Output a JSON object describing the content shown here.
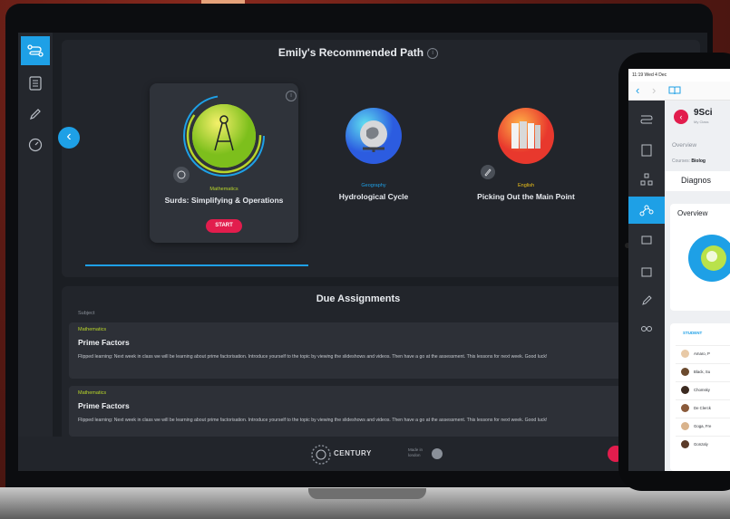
{
  "path": {
    "title": "Emily's Recommended Path",
    "cards": [
      {
        "subject": "Mathematics",
        "topic": "Surds: Simplifying & Operations",
        "start_label": "START",
        "subject_color": "#b9d62a"
      },
      {
        "subject": "Geography",
        "topic": "Hydrological Cycle",
        "subject_color": "#1ea0e6"
      },
      {
        "subject": "English",
        "topic": "Picking Out the Main Point",
        "subject_color": "#f0c419"
      }
    ]
  },
  "assignments": {
    "title": "Due Assignments",
    "subject_header": "Subject",
    "items": [
      {
        "subject": "Mathematics",
        "title": "Prime Factors",
        "desc": "Flipped learning: Next week in class we will be learning about prime factorisation. Introduce yourself to the topic by viewing the slideshows and videos. Then have a go at the assessment. This lessons for next week. Good luck!"
      },
      {
        "subject": "Mathematics",
        "title": "Prime Factors",
        "desc": "Flipped learning: Next week in class we will be learning about prime factorisation. Introduce yourself to the topic by viewing the slideshows and videos. Then have a go at the assessment. This lessons for next week. Good luck!"
      }
    ]
  },
  "footer": {
    "brand": "CENTURY",
    "made_by": "Made in london"
  },
  "tablet": {
    "status": "11:19  Wed 4 Dec",
    "course": "9Sci",
    "course_sub": "My Class",
    "overview_label": "Overview",
    "courses_label": "Courses:",
    "courses_value": "Biolog",
    "diag_label": "Diagnos",
    "card_title": "Overview",
    "students_header": "STUDENT",
    "students": [
      "Amaro, P",
      "Black, Su",
      "Chomsky",
      "De Clerck",
      "Goga, Fre",
      "Gonzaly"
    ]
  },
  "colors": {
    "accent": "#1ea0e6",
    "start": "#e21d4d",
    "math": "#b9d62a"
  }
}
